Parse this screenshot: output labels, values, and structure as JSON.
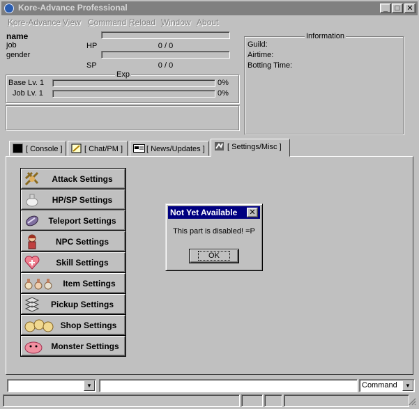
{
  "window": {
    "title": "Kore-Advance Professional",
    "min": "_",
    "max": "□",
    "close": "✕"
  },
  "menu": [
    "Kore-Advance",
    "View",
    "Command",
    "Reload",
    "Window",
    "About"
  ],
  "character": {
    "name": "name",
    "job": "job",
    "gender": "gender",
    "hp_label": "HP",
    "hp_value": "0 / 0",
    "sp_label": "SP",
    "sp_value": "0 / 0"
  },
  "exp": {
    "title": "Exp",
    "base_label": "Base Lv. 1",
    "base_pct": "0%",
    "job_label": "Job Lv. 1",
    "job_pct": "0%"
  },
  "information": {
    "title": "Information",
    "guild": "Guild:",
    "airtime": "Airtime:",
    "botting_time": "Botting Time:"
  },
  "tabs": [
    {
      "label": "[ Console ]",
      "icon": "console-icon"
    },
    {
      "label": "[ Chat/PM ]",
      "icon": "chat-icon"
    },
    {
      "label": "[ News/Updates ]",
      "icon": "news-icon"
    },
    {
      "label": "[ Settings/Misc ]",
      "icon": "settings-icon",
      "active": true
    }
  ],
  "settings_buttons": [
    {
      "label": "Attack Settings",
      "icon": "attack-icon"
    },
    {
      "label": "HP/SP Settings",
      "icon": "potion-icon"
    },
    {
      "label": "Teleport Settings",
      "icon": "wing-icon"
    },
    {
      "label": "NPC Settings",
      "icon": "npc-icon"
    },
    {
      "label": "Skill Settings",
      "icon": "skill-icon"
    },
    {
      "label": "Item Settings",
      "icon": "items-icon"
    },
    {
      "label": "Pickup Settings",
      "icon": "pickup-icon"
    },
    {
      "label": "Shop Settings",
      "icon": "shop-icon"
    },
    {
      "label": "Monster Settings",
      "icon": "monster-icon"
    }
  ],
  "dialog": {
    "title": "Not Yet Available",
    "message": "This part is disabled! =P",
    "ok": "OK"
  },
  "bottom": {
    "left_combo_value": "",
    "command_input_value": "",
    "mode_select": "Command"
  },
  "colors": {
    "dialog_title_bg": "#000080",
    "face": "#c0c0c0",
    "titlebar_inactive": "#808080"
  }
}
